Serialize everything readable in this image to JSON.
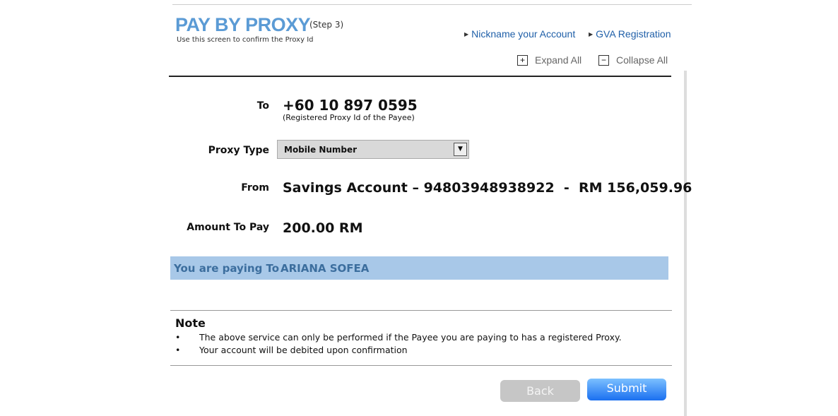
{
  "header": {
    "title": "PAY BY PROXY",
    "step": "(Step 3)",
    "subtitle": "Use this screen to confirm the Proxy Id",
    "links": [
      "Nickname your Account",
      "GVA Registration"
    ],
    "expand_all": "Expand All",
    "collapse_all": "Collapse All"
  },
  "form": {
    "to_label": "To",
    "to_value": "+60 10 897 0595",
    "to_hint": "(Registered Proxy Id of the Payee)",
    "proxy_type_label": "Proxy Type",
    "proxy_type_value": "Mobile Number",
    "from_label": "From",
    "from_value": "Savings Account – 94803948938922  -  RM 156,059.96",
    "amount_label": "Amount To Pay",
    "amount_value": "200.00 RM",
    "paying_to_label": "You are paying To",
    "paying_to_value": "ARIANA SOFEA"
  },
  "note": {
    "title": "Note",
    "items": [
      "The above service can only be performed if the Payee you are paying to has a registered Proxy.",
      "Your account will be debited upon confirmation"
    ]
  },
  "buttons": {
    "back": "Back",
    "submit": "Submit"
  },
  "colors": {
    "title": "#5b9bd5",
    "band": "#a8c8e8",
    "submit": "#1a6ff0"
  }
}
